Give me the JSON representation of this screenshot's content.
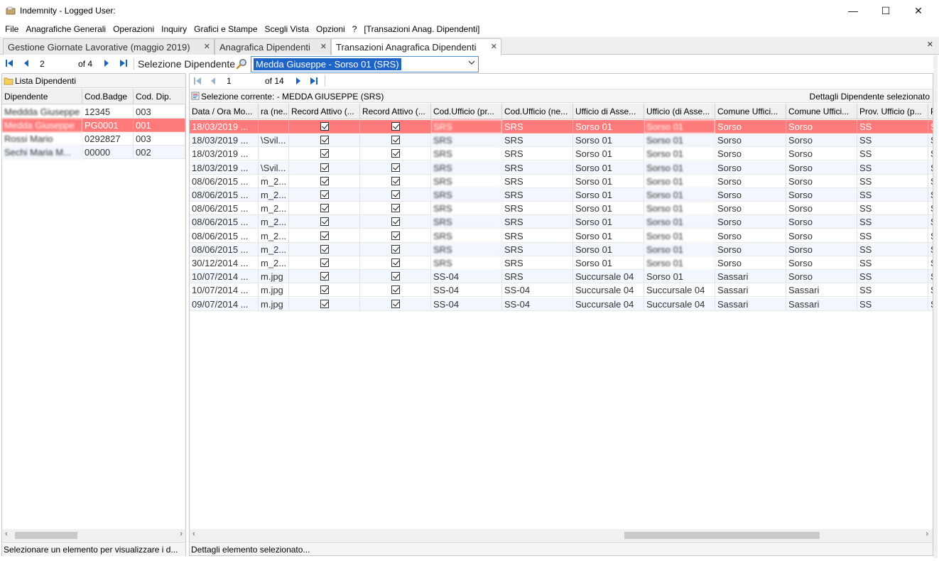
{
  "window": {
    "title": "Indemnity - Logged User:",
    "controls": {
      "minimize": "—",
      "maximize": "☐",
      "close": "✕"
    }
  },
  "menu": [
    "File",
    "Anagrafiche Generali",
    "Operazioni",
    "Inquiry",
    "Grafici e Stampe",
    "Scegli Vista",
    "Opzioni",
    "?",
    "[Transazioni Anag. Dipendenti]"
  ],
  "tabs": [
    {
      "label": "Gestione Giornate Lavorative (maggio 2019)",
      "close": "✕"
    },
    {
      "label": "Anagrafica Dipendenti",
      "close": "✕"
    },
    {
      "label": "Transazioni Anagrafica Dipendenti",
      "close": "✕"
    }
  ],
  "tabs_close_all": "✕",
  "toolbar": {
    "position": "2",
    "of_label": "of 4",
    "selezione_label": "Selezione Dipendente",
    "combo_value": "Medda Giuseppe - Sorso 01 (SRS)"
  },
  "left_panel": {
    "title": "Lista Dipendenti",
    "columns": [
      "Dipendente",
      "Cod.Badge",
      "Cod. Dip."
    ],
    "rows": [
      [
        "Meddda Giuseppe",
        "12345",
        "003"
      ],
      [
        "Medda Giuseppe",
        "PG0001",
        "001"
      ],
      [
        "Rossi Mario",
        "0292827",
        "003"
      ],
      [
        "Sechi Maria M...",
        "00000",
        "002"
      ]
    ],
    "selected_row": 1,
    "status": "Selezionare un elemento per visualizzare i d..."
  },
  "right_panel": {
    "position": "1",
    "of_label": "of 14",
    "current_selection": "Selezione corrente:  - MEDDA GIUSEPPE (SRS)",
    "details_label": "Dettagli Dipendente selezionato",
    "columns": [
      "Data / Ora Mo...",
      "ra (ne...",
      "Record Attivo (...",
      "Record Attivo (...",
      "Cod.Ufficio (pr...",
      "Cod.Ufficio (ne...",
      "Ufficio di Asse...",
      "Ufficio (di Asse...",
      "Comune Uffici...",
      "Comune Uffici...",
      "Prov. Ufficio (p...",
      "P"
    ],
    "rows": [
      [
        "18/03/2019 ...",
        "",
        true,
        true,
        "SRS",
        "SRS",
        "Sorso 01",
        "Sorso 01",
        "Sorso",
        "Sorso",
        "SS",
        "S"
      ],
      [
        "18/03/2019 ...",
        "\\Svil...",
        true,
        true,
        "SRS",
        "SRS",
        "Sorso 01",
        "Sorso 01",
        "Sorso",
        "Sorso",
        "SS",
        "S"
      ],
      [
        "18/03/2019 ...",
        "",
        true,
        true,
        "SRS",
        "SRS",
        "Sorso 01",
        "Sorso 01",
        "Sorso",
        "Sorso",
        "SS",
        "S"
      ],
      [
        "18/03/2019 ...",
        "\\Svil...",
        true,
        true,
        "SRS",
        "SRS",
        "Sorso 01",
        "Sorso 01",
        "Sorso",
        "Sorso",
        "SS",
        "S"
      ],
      [
        "08/06/2015 ...",
        "m_2...",
        true,
        true,
        "SRS",
        "SRS",
        "Sorso 01",
        "Sorso 01",
        "Sorso",
        "Sorso",
        "SS",
        "S"
      ],
      [
        "08/06/2015 ...",
        "m_2...",
        true,
        true,
        "SRS",
        "SRS",
        "Sorso 01",
        "Sorso 01",
        "Sorso",
        "Sorso",
        "SS",
        "S"
      ],
      [
        "08/06/2015 ...",
        "m_2...",
        true,
        true,
        "SRS",
        "SRS",
        "Sorso 01",
        "Sorso 01",
        "Sorso",
        "Sorso",
        "SS",
        "S"
      ],
      [
        "08/06/2015 ...",
        "m_2...",
        true,
        true,
        "SRS",
        "SRS",
        "Sorso 01",
        "Sorso 01",
        "Sorso",
        "Sorso",
        "SS",
        "S"
      ],
      [
        "08/06/2015 ...",
        "m_2...",
        true,
        true,
        "SRS",
        "SRS",
        "Sorso 01",
        "Sorso 01",
        "Sorso",
        "Sorso",
        "SS",
        "S"
      ],
      [
        "08/06/2015 ...",
        "m_2...",
        true,
        true,
        "SRS",
        "SRS",
        "Sorso 01",
        "Sorso 01",
        "Sorso",
        "Sorso",
        "SS",
        "S"
      ],
      [
        "30/12/2014 ...",
        "m_2...",
        true,
        true,
        "SRS",
        "SRS",
        "Sorso 01",
        "Sorso 01",
        "Sorso",
        "Sorso",
        "SS",
        "S"
      ],
      [
        "10/07/2014 ...",
        "m.jpg",
        true,
        true,
        "SS-04",
        "SRS",
        "Succursale 04",
        "Sorso 01",
        "Sassari",
        "Sorso",
        "SS",
        "S"
      ],
      [
        "10/07/2014 ...",
        "m.jpg",
        true,
        true,
        "SS-04",
        "SS-04",
        "Succursale 04",
        "Succursale 04",
        "Sassari",
        "Sassari",
        "SS",
        "S"
      ],
      [
        "09/07/2014 ...",
        "m.jpg",
        true,
        true,
        "SS-04",
        "SS-04",
        "Succursale 04",
        "Succursale 04",
        "Sassari",
        "Sassari",
        "SS",
        "S"
      ]
    ],
    "selected_row": 0,
    "status": "Dettagli elemento selezionato..."
  },
  "colors": {
    "selected_row": "#ff7b7b",
    "alt_row": "#f1f7fd",
    "nav_blue": "#1565c0",
    "combo_highlight": "#1e64c8"
  }
}
